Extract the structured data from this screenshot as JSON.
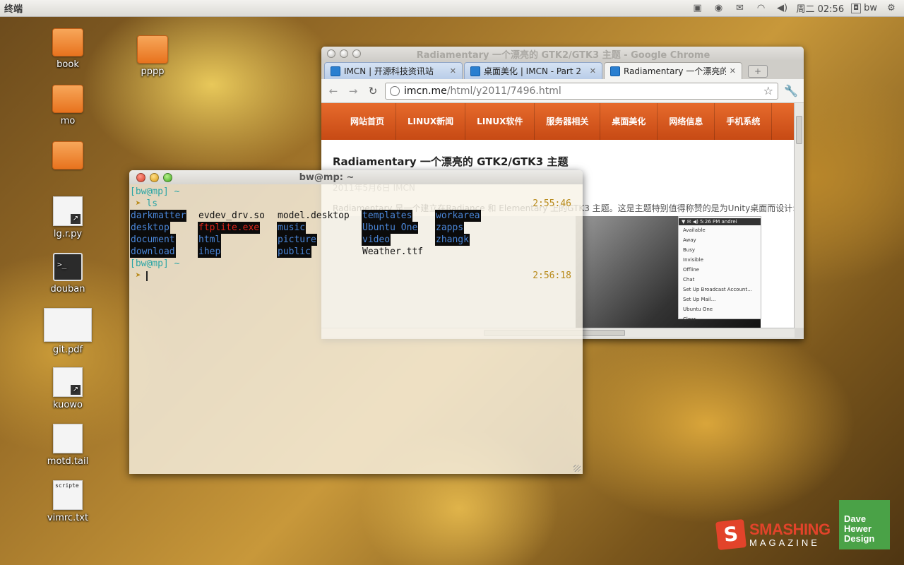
{
  "panel": {
    "app_title": "终端",
    "clock": "周二 02:56",
    "user": "bw"
  },
  "desktop_icons": [
    {
      "label": "book",
      "kind": "folder"
    },
    {
      "label": "pppp",
      "kind": "folder"
    },
    {
      "label": "mo",
      "kind": "folder"
    },
    {
      "label": "",
      "kind": "folder"
    },
    {
      "label": "lg.r.py",
      "kind": "link"
    },
    {
      "label": "douban",
      "kind": "terminal"
    },
    {
      "label": "git.pdf",
      "kind": "pdf"
    },
    {
      "label": "kuowo",
      "kind": "link"
    },
    {
      "label": "motd.tail",
      "kind": "file"
    },
    {
      "label": "vimrc.txt",
      "kind": "text",
      "preview": "scripte"
    }
  ],
  "chrome": {
    "title": "Radiamentary 一个漂亮的 GTK2/GTK3 主题 - Google Chrome",
    "tabs": [
      {
        "label": "IMCN | 开源科技资讯站",
        "close": "✕"
      },
      {
        "label": "桌面美化 | IMCN - Part 2",
        "close": "✕"
      },
      {
        "label": "Radiamentary 一个漂亮的 (",
        "close": "✕"
      }
    ],
    "new_tab": "+",
    "url_host": "imcn.me",
    "url_path": "/html/y2011/7496.html",
    "nav": [
      "网站首页",
      "LINUX新闻",
      "LINUX软件",
      "服务器相关",
      "桌面美化",
      "网络信息",
      "手机系统"
    ],
    "article_title": "Radiamentary 一个漂亮的 GTK2/GTK3 主题",
    "article_meta": "2011年5月6日   IMCN",
    "article_intro": "Radiamentary 是一个建立在Radiance 和 Elementary 上的GTK3 主题。这是主题特别值得称赞的是为Unity桌面而设计:",
    "screenshot_menu": [
      "Available",
      "Away",
      "Busy",
      "Invisible",
      "Offline",
      "Chat",
      "Set Up Broadcast Account...",
      "Set Up Mail...",
      "Ubuntu One",
      "Clear"
    ],
    "screenshot_clock": "5:26 PM",
    "screenshot_user": "andrei"
  },
  "terminal": {
    "title": "bw@mp: ~",
    "prompt1": "[bw@mp] ~",
    "arrow": "➤",
    "command": "ls",
    "time1": "2:55:46",
    "files": [
      {
        "name": "darkmatter",
        "style": "hl"
      },
      {
        "name": "evdev_drv.so",
        "style": "plain"
      },
      {
        "name": "model.desktop",
        "style": "plain"
      },
      {
        "name": "templates",
        "style": "hl"
      },
      {
        "name": "workarea",
        "style": "hl"
      },
      {
        "name": "desktop",
        "style": "hl"
      },
      {
        "name": "ftplite.exe",
        "style": "hl-red"
      },
      {
        "name": "music",
        "style": "hl"
      },
      {
        "name": "Ubuntu One",
        "style": "hl"
      },
      {
        "name": "zapps",
        "style": "hl"
      },
      {
        "name": "document",
        "style": "hl"
      },
      {
        "name": "html",
        "style": "hl"
      },
      {
        "name": "picture",
        "style": "hl"
      },
      {
        "name": "video",
        "style": "hl"
      },
      {
        "name": "zhangk",
        "style": "hl"
      },
      {
        "name": "download",
        "style": "hl"
      },
      {
        "name": "ihep",
        "style": "hl"
      },
      {
        "name": "public",
        "style": "hl"
      },
      {
        "name": "Weather.ttf",
        "style": "plain"
      }
    ],
    "prompt2": "[bw@mp] ~",
    "time2": "2:56:18"
  },
  "logos": {
    "smashing": "SMASHING",
    "magazine": "MAGAZINE",
    "dave": [
      "Dave",
      "Hewer",
      "Design"
    ]
  }
}
